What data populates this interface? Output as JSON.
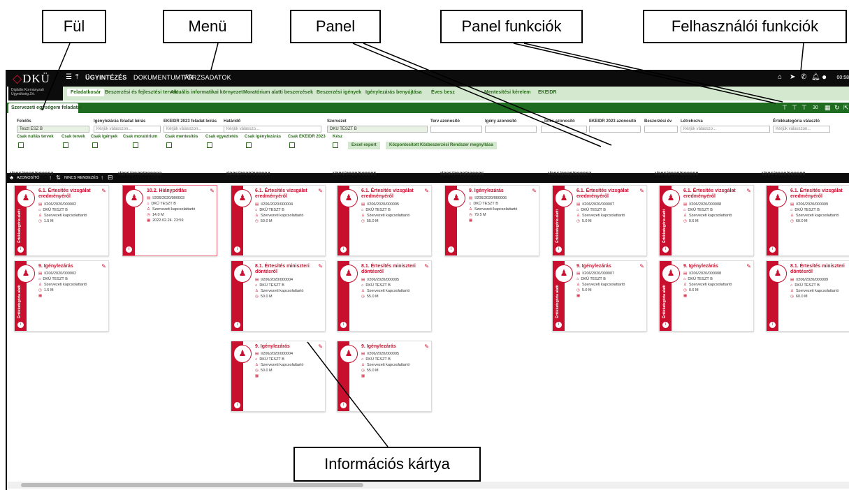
{
  "callouts": {
    "ful": "Fül",
    "menu": "Menü",
    "panel": "Panel",
    "panel_funkciok": "Panel funkciók",
    "felhasznaloi_funkciok": "Felhasználói funkciók",
    "informacios_kartya": "Információs kártya"
  },
  "app": {
    "logo": "DKÜ",
    "logo_sub": "Digitális Kormányzati Ügynökség Zrt.",
    "clock": "00:58"
  },
  "menu": {
    "items": [
      "ÜGYINTÉZÉS",
      "DOKUMENTUMTÁR",
      "TÖRZSADATOK"
    ],
    "active": "ÜGYINTÉZÉS"
  },
  "subnav": {
    "items": [
      "Feladatkosár",
      "Beszerzési és fejlesztési tervek",
      "Aktuális informatikai környezet",
      "Moratórium alatti beszerzések",
      "Beszerzési igények",
      "Igénylezárás benyújtása",
      "Éves besz",
      "Mentesítési kérelem",
      "EKEIDR"
    ],
    "active": "Feladatkosár"
  },
  "tab": {
    "label": "Szervezeti egységem feladatai"
  },
  "filters": {
    "felelos": {
      "label": "Felelős",
      "value": "Teszt ESZ B"
    },
    "igenylezaras": {
      "label": "Igénylezárás feladat leírás",
      "placeholder": "Kérjük válasszon..."
    },
    "ekeidr_leiras": {
      "label": "EKEIDR 2023 feladat leírás",
      "placeholder": "Kérjük válasszon..."
    },
    "hatarido": {
      "label": "Határidő",
      "placeholder": "Kérjük válasszo..."
    },
    "szervezet": {
      "label": "Szervezet",
      "value": "DKÜ TESZT B"
    },
    "terv": {
      "label": "Terv azonosító"
    },
    "igeny": {
      "label": "Igény azonosító"
    },
    "ertesites": {
      "label": "...tetés azonosító"
    },
    "ekeidr_azon": {
      "label": "EKEIDR 2023 azonosító"
    },
    "ev": {
      "label": "Beszerzési év"
    },
    "letrehozva": {
      "label": "Létrehozva",
      "placeholder": "Kérjük válasszo..."
    },
    "ertekkategoria": {
      "label": "Értékkategória választó",
      "placeholder": "Kérjük válasszon..."
    }
  },
  "checkboxes": [
    "Csak nullás tervek",
    "Csak tervek",
    "Csak igények",
    "Csak moratórium",
    "Csak mentesítés",
    "Csak egyeztetés",
    "Csak igénylezárás",
    "Csak EKEIDR 2023",
    "Kész"
  ],
  "buttons": {
    "excel": "Excel export",
    "kozbeszerzesi": "Központosított Közbeszerzési Rendszer megnyitása"
  },
  "sortbar": {
    "azonosito": "AZONOSÍTÓ",
    "rendezes": "NINCS RENDEZÉS"
  },
  "strip_label": "Értékkategória alatti",
  "columns": [
    {
      "id": "I/206/2020/000002",
      "cards": [
        {
          "title": "6.1. Értesítés vizsgálat eredményéről",
          "rows": [
            "I/206/2020/000002",
            "DKÜ TESZT B",
            "Szervezeti kapcsolattartó",
            "1.5 M"
          ],
          "strip": true
        },
        {
          "title": "9. Igénylezárás",
          "rows": [
            "I/206/2020/000002",
            "DKÜ TESZT B",
            "Szervezeti kapcsolattartó",
            "1.5 M",
            ""
          ],
          "strip": true
        }
      ]
    },
    {
      "id": "I/206/2020/000003",
      "cards": [
        {
          "title": "10.2. Hiánypótlás",
          "rows": [
            "I/206/2020/000003",
            "DKÜ TESZT B",
            "Szervezeti kapcsolattartó",
            "14.0 M",
            "2022.02.24. 23:59"
          ],
          "strip": false,
          "selected": true
        }
      ]
    },
    {
      "id": "I/206/2020/000004",
      "cards": [
        {
          "title": "6.1. Értesítés vizsgálat eredményéről",
          "rows": [
            "I/206/2020/000004",
            "DKÜ TESZT B",
            "Szervezeti kapcsolattartó",
            "50.0 M"
          ],
          "strip": false
        },
        {
          "title": "8.1. Értesítés miniszteri döntésről",
          "rows": [
            "I/206/2020/000004",
            "DKÜ TESZT B",
            "Szervezeti kapcsolattartó",
            "50.0 M"
          ],
          "strip": false
        },
        {
          "title": "9. Igénylezárás",
          "rows": [
            "I/206/2020/000004",
            "DKÜ TESZT B",
            "Szervezeti kapcsolattartó",
            "50.0 M",
            ""
          ],
          "strip": false
        }
      ]
    },
    {
      "id": "I/206/2020/000005",
      "cards": [
        {
          "title": "6.1. Értesítés vizsgálat eredményéről",
          "rows": [
            "I/206/2020/000005",
            "DKÜ TESZT B",
            "Szervezeti kapcsolattartó",
            "55.0 M"
          ],
          "strip": false
        },
        {
          "title": "8.1. Értesítés miniszteri döntésről",
          "rows": [
            "I/206/2020/000005",
            "DKÜ TESZT B",
            "Szervezeti kapcsolattartó",
            "55.0 M"
          ],
          "strip": false
        },
        {
          "title": "9. Igénylezárás",
          "rows": [
            "I/206/2020/000005",
            "DKÜ TESZT B",
            "Szervezeti kapcsolattartó",
            "55.0 M",
            ""
          ],
          "strip": false
        }
      ]
    },
    {
      "id": "I/206/2020/000006",
      "cards": [
        {
          "title": "9. Igénylezárás",
          "rows": [
            "I/206/2020/000006",
            "DKÜ TESZT B",
            "Szervezeti kapcsolattartó",
            "79.5 M",
            ""
          ],
          "strip": false
        }
      ]
    },
    {
      "id": "I/206/2020/000007",
      "cards": [
        {
          "title": "6.1. Értesítés vizsgálat eredményéről",
          "rows": [
            "I/206/2020/000007",
            "DKÜ TESZT B",
            "Szervezeti kapcsolattartó",
            "5.0 M"
          ],
          "strip": true
        },
        {
          "title": "9. Igénylezárás",
          "rows": [
            "I/206/2020/000007",
            "DKÜ TESZT B",
            "Szervezeti kapcsolattartó",
            "5.0 M",
            ""
          ],
          "strip": true
        }
      ]
    },
    {
      "id": "I/206/2020/000008",
      "cards": [
        {
          "title": "6.1. Értesítés vizsgálat eredményéről",
          "rows": [
            "I/206/2020/000008",
            "DKÜ TESZT B",
            "Szervezeti kapcsolattartó",
            "0.6 M"
          ],
          "strip": true
        },
        {
          "title": "9. Igénylezárás",
          "rows": [
            "I/206/2020/000008",
            "DKÜ TESZT B",
            "Szervezeti kapcsolattartó",
            "0.6 M",
            ""
          ],
          "strip": true
        }
      ]
    },
    {
      "id": "I/206/2020/000009",
      "cards": [
        {
          "title": "6.1. Értesítés vizsgálat eredményéről",
          "rows": [
            "I/206/2020/000009",
            "DKÜ TESZT B",
            "Szervezeti kapcsolattartó",
            "60.0 M"
          ],
          "strip": false
        },
        {
          "title": "8.1. Értesítés miniszteri döntésről",
          "rows": [
            "I/206/2020/000009",
            "DKÜ TESZT B",
            "Szervezeti kapcsolattartó",
            "60.0 M"
          ],
          "strip": false
        }
      ]
    }
  ]
}
